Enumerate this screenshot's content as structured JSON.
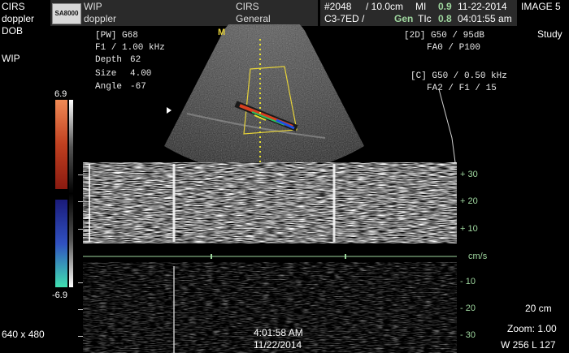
{
  "left_info": {
    "phantom": "CIRS",
    "mode": "doppler",
    "dob": "DOB",
    "wip": "WIP",
    "resolution": "640 x 480"
  },
  "header": {
    "logo": "SA8000",
    "wip": "WIP",
    "doppler": "doppler",
    "cirs": "CIRS",
    "general": "General",
    "file_no": "#2048",
    "depth_scale": "/ 10.0cm",
    "mi_label": "MI",
    "mi_value": "0.9",
    "date": "11-22-2014",
    "image_label": "IMAGE 5",
    "probe": "C3-7ED /",
    "gen_label": "Gen",
    "tic_label": "TIc",
    "tic_value": "0.8",
    "time": "04:01:55 am",
    "study": "Study"
  },
  "pw_params": {
    "line1": "[PW]  G68",
    "line2": "F1 / 1.00 kHz",
    "depth_label": "Depth",
    "depth_value": "62",
    "size_label": "Size",
    "size_value": "4.00",
    "angle_label": "Angle",
    "angle_value": "-67"
  },
  "right_params": {
    "line1": "[2D] G50 / 95dB",
    "line2": "FA0 / P100",
    "line3": "[C] G50 / 0.50 kHz",
    "line4": "FA2 / F1 / 15"
  },
  "color_bar": {
    "top_value": "6.9",
    "bottom_value": "-6.9",
    "top_color": "#f08a55",
    "mid_top_color": "#8a1a10",
    "mid_bottom_color": "#1a1a7a",
    "bottom_color": "#40e0b0"
  },
  "marker": {
    "m": "M"
  },
  "velocity_scale": {
    "p30": "+ 30",
    "p20": "+ 20",
    "p10": "+ 10",
    "unit": "cm/s",
    "n10": "- 10",
    "n20": "- 20",
    "n30": "- 30"
  },
  "footer": {
    "time": "4:01:58 AM",
    "date": "11/22/2014",
    "depth": "20 cm",
    "zoom": "Zoom: 1.00",
    "window": "W 256 L 127"
  },
  "accent_color": "#9fd79f"
}
